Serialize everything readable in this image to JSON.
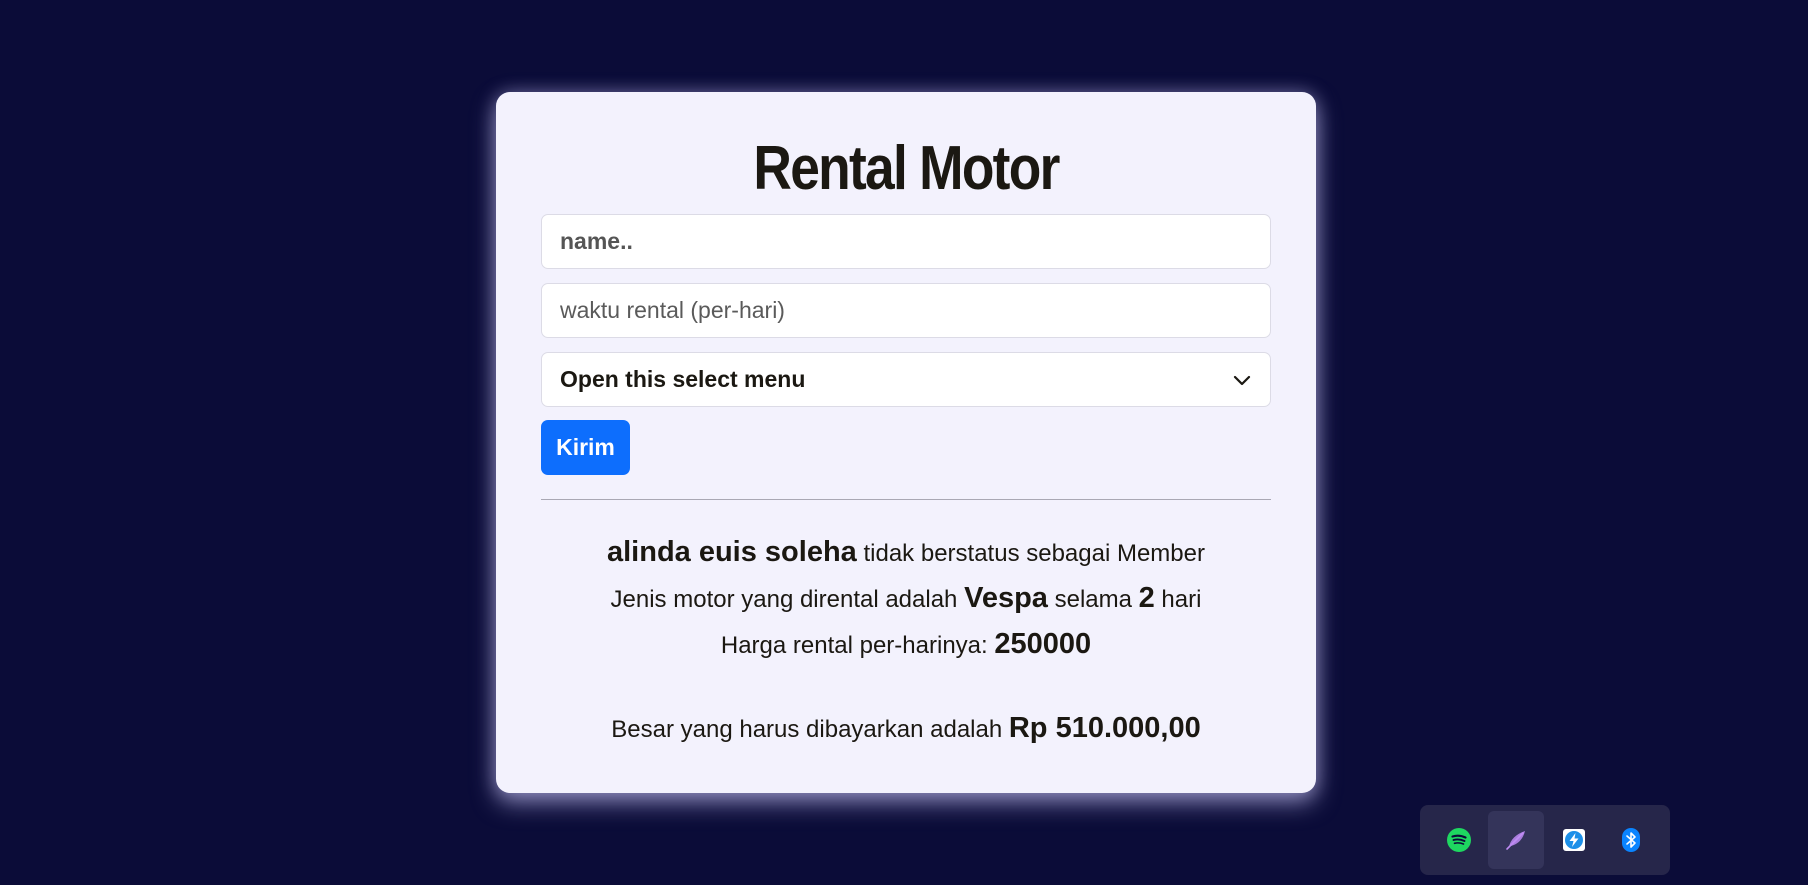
{
  "form": {
    "title": "Rental Motor",
    "name_placeholder": "name..",
    "duration_placeholder": "waktu rental (per-hari)",
    "select_value": "Open this select menu",
    "submit_label": "Kirim"
  },
  "result": {
    "name": "alinda euis soleha",
    "member_status_text": " tidak berstatus sebagai Member",
    "motor_prefix": "Jenis motor yang dirental adalah ",
    "motor": "Vespa",
    "duration_prefix": " selama ",
    "days": "2",
    "days_suffix": " hari",
    "price_prefix": "Harga rental per-harinya: ",
    "price": "250000",
    "total_prefix": "Besar yang harus dibayarkan adalah ",
    "total": "Rp 510.000,00"
  },
  "tray": {
    "items": [
      "spotify-icon",
      "feather-icon",
      "lightning-icon",
      "bluetooth-icon"
    ],
    "colors": {
      "spotify": "#1ed760",
      "feather": "#c08cf5",
      "lightning": "#1c8fe8",
      "bluetooth": "#0a84ff"
    }
  }
}
